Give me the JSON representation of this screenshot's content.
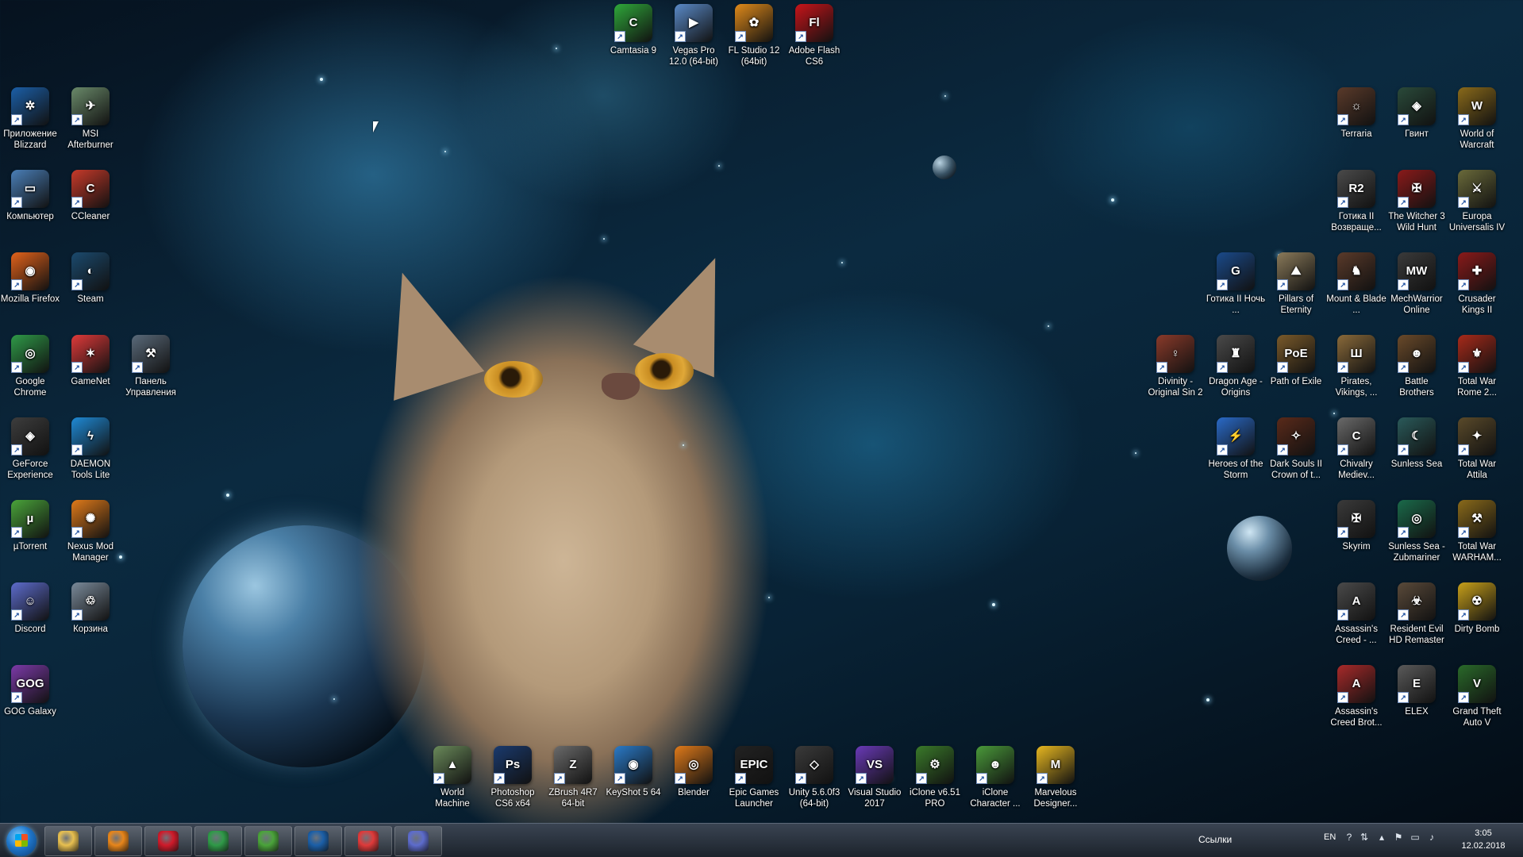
{
  "desktop": {
    "left_col1": [
      {
        "name": "blizzard-icon",
        "label": "Приложение Blizzard",
        "color": "#1b5fa8",
        "glyph": "✲"
      },
      {
        "name": "computer-icon",
        "label": "Компьютер",
        "color": "#4a7fb8",
        "glyph": "▭"
      },
      {
        "name": "firefox-icon",
        "label": "Mozilla Firefox",
        "color": "#e2621b",
        "glyph": "◉"
      },
      {
        "name": "chrome-icon",
        "label": "Google Chrome",
        "color": "#2f9a48",
        "glyph": "◎"
      },
      {
        "name": "geforce-icon",
        "label": "GeForce Experience",
        "color": "#3d3d3d",
        "glyph": "◈"
      },
      {
        "name": "utorrent-icon",
        "label": "µTorrent",
        "color": "#4aa43a",
        "glyph": "µ"
      },
      {
        "name": "discord-icon",
        "label": "Discord",
        "color": "#5d6ccd",
        "glyph": "☺"
      },
      {
        "name": "gog-icon",
        "label": "GOG Galaxy",
        "color": "#7c3aa8",
        "glyph": "GOG"
      }
    ],
    "left_col2": [
      {
        "name": "msi-afterburner-icon",
        "label": "MSI Afterburner",
        "color": "#6a8a6a",
        "glyph": "✈"
      },
      {
        "name": "ccleaner-icon",
        "label": "CCleaner",
        "color": "#c83a2a",
        "glyph": "C"
      },
      {
        "name": "steam-icon",
        "label": "Steam",
        "color": "#1b4a6e",
        "glyph": "◐"
      },
      {
        "name": "gamenet-icon",
        "label": "GameNet",
        "color": "#e03a3a",
        "glyph": "✶"
      },
      {
        "name": "daemon-tools-icon",
        "label": "DAEMON Tools Lite",
        "color": "#1f8ad6",
        "glyph": "ϟ"
      },
      {
        "name": "nexus-mod-icon",
        "label": "Nexus Mod Manager",
        "color": "#e07a1a",
        "glyph": "✺"
      },
      {
        "name": "recycle-bin-icon",
        "label": "Корзина",
        "color": "#7a8a9a",
        "glyph": "♲"
      }
    ],
    "left_col3": [
      {
        "name": "control-panel-icon",
        "label": "Панель Управления",
        "color": "#5a6a7a",
        "glyph": "⚒"
      }
    ],
    "top_row": [
      {
        "name": "camtasia-icon",
        "label": "Camtasia 9",
        "color": "#2fa83a",
        "glyph": "C"
      },
      {
        "name": "vegas-pro-icon",
        "label": "Vegas Pro 12.0 (64-bit)",
        "color": "#5a8ac8",
        "glyph": "▶"
      },
      {
        "name": "fl-studio-icon",
        "label": "FL Studio 12 (64bit)",
        "color": "#e08a1a",
        "glyph": "✿"
      },
      {
        "name": "adobe-flash-icon",
        "label": "Adobe Flash CS6",
        "color": "#c8141a",
        "glyph": "Fl"
      }
    ],
    "bottom_row": [
      {
        "name": "world-machine-icon",
        "label": "World Machine",
        "color": "#6a8a5a",
        "glyph": "▲"
      },
      {
        "name": "photoshop-icon",
        "label": "Photoshop CS6 x64",
        "color": "#1a3a6e",
        "glyph": "Ps"
      },
      {
        "name": "zbrush-icon",
        "label": "ZBrush 4R7 64-bit",
        "color": "#6a6a6a",
        "glyph": "Z"
      },
      {
        "name": "keyshot-icon",
        "label": "KeyShot 5 64",
        "color": "#2a7ac8",
        "glyph": "◉"
      },
      {
        "name": "blender-icon",
        "label": "Blender",
        "color": "#e07a1a",
        "glyph": "◎"
      },
      {
        "name": "epic-games-icon",
        "label": "Epic Games Launcher",
        "color": "#222222",
        "glyph": "EPIC"
      },
      {
        "name": "unity-icon",
        "label": "Unity 5.6.0f3 (64-bit)",
        "color": "#3a3a3a",
        "glyph": "◇"
      },
      {
        "name": "visual-studio-icon",
        "label": "Visual Studio 2017",
        "color": "#6a3ab8",
        "glyph": "VS"
      },
      {
        "name": "iclone-pro-icon",
        "label": "iClone v6.51 PRO",
        "color": "#3a7a2a",
        "glyph": "⚙"
      },
      {
        "name": "iclone-character-icon",
        "label": "iClone Character ...",
        "color": "#4a9a3a",
        "glyph": "☻"
      },
      {
        "name": "marvelous-designer-icon",
        "label": "Marvelous Designer...",
        "color": "#e8b820",
        "glyph": "M"
      }
    ],
    "right_grid": [
      {
        "name": "terraria-icon",
        "label": "Terraria",
        "color": "#5a3a2a",
        "glyph": "☼",
        "col": 5,
        "row": 0
      },
      {
        "name": "gwent-icon",
        "label": "Гвинт",
        "color": "#2a4a3a",
        "glyph": "◈",
        "col": 6,
        "row": 0
      },
      {
        "name": "wow-icon",
        "label": "World of Warcraft",
        "color": "#8a6a1a",
        "glyph": "W",
        "col": 7,
        "row": 0
      },
      {
        "name": "gothic2-icon",
        "label": "Готика II Возвраще...",
        "color": "#4a4a4a",
        "glyph": "R2",
        "col": 5,
        "row": 1
      },
      {
        "name": "witcher3-icon",
        "label": "The Witcher 3 Wild Hunt",
        "color": "#8a1a1a",
        "glyph": "✠",
        "col": 6,
        "row": 1
      },
      {
        "name": "europa-universalis-icon",
        "label": "Europa Universalis IV",
        "color": "#6a6a3a",
        "glyph": "⚔",
        "col": 7,
        "row": 1
      },
      {
        "name": "gothic2-night-icon",
        "label": "Готика II Ночь ...",
        "color": "#1a4a8a",
        "glyph": "G",
        "col": 4,
        "row": 2
      },
      {
        "name": "pillars-icon",
        "label": "Pillars of Eternity",
        "color": "#8a7a5a",
        "glyph": "⛰",
        "col": 5,
        "row": 2
      },
      {
        "name": "mount-blade-icon",
        "label": "Mount & Blade ...",
        "color": "#5a3a2a",
        "glyph": "♞",
        "col": 6,
        "row": 2
      },
      {
        "name": "mechwarrior-icon",
        "label": "MechWarrior Online",
        "color": "#3a3a3a",
        "glyph": "MW",
        "col": 7,
        "row": 2
      },
      {
        "name": "crusader-kings-icon",
        "label": "Crusader Kings II",
        "color": "#8a1a1a",
        "glyph": "✚",
        "col": 8,
        "row": 2
      },
      {
        "name": "divinity-icon",
        "label": "Divinity - Original Sin 2",
        "color": "#8a3a2a",
        "glyph": "♀",
        "col": 2,
        "row": 3
      },
      {
        "name": "dragon-age-icon",
        "label": "Dragon Age - Origins",
        "color": "#4a4a4a",
        "glyph": "♜",
        "col": 3,
        "row": 3
      },
      {
        "name": "path-of-exile-icon",
        "label": "Path of Exile",
        "color": "#7a5a2a",
        "glyph": "PoE",
        "col": 4,
        "row": 3
      },
      {
        "name": "pirates-vikings-icon",
        "label": "Pirates, Vikings, ...",
        "color": "#8a6a3a",
        "glyph": "Ш",
        "col": 5,
        "row": 3
      },
      {
        "name": "battle-brothers-icon",
        "label": "Battle Brothers",
        "color": "#6a4a2a",
        "glyph": "☻",
        "col": 6,
        "row": 3
      },
      {
        "name": "total-war-rome-icon",
        "label": "Total War Rome 2...",
        "color": "#a82a1a",
        "glyph": "⚜",
        "col": 7,
        "row": 3
      },
      {
        "name": "heroes-storm-icon",
        "label": "Heroes of the Storm",
        "color": "#2a6ac8",
        "glyph": "⚡",
        "col": 4,
        "row": 4
      },
      {
        "name": "dark-souls-icon",
        "label": "Dark Souls II Crown of t...",
        "color": "#5a2a1a",
        "glyph": "✧",
        "col": 5,
        "row": 4
      },
      {
        "name": "chivalry-icon",
        "label": "Chivalry Mediev...",
        "color": "#6a6a6a",
        "glyph": "C",
        "col": 6,
        "row": 4
      },
      {
        "name": "sunless-sea-icon",
        "label": "Sunless Sea",
        "color": "#2a5a5a",
        "glyph": "☾",
        "col": 7,
        "row": 4
      },
      {
        "name": "total-war-attila-icon",
        "label": "Total War Attila",
        "color": "#5a4a2a",
        "glyph": "✦",
        "col": 8,
        "row": 4
      },
      {
        "name": "skyrim-icon",
        "label": "Skyrim",
        "color": "#3a3a3a",
        "glyph": "✠",
        "col": 5,
        "row": 5
      },
      {
        "name": "sunless-sea-zubmariner-icon",
        "label": "Sunless Sea - Zubmariner",
        "color": "#1a6a4a",
        "glyph": "◎",
        "col": 6,
        "row": 5
      },
      {
        "name": "total-war-warhammer-icon",
        "label": "Total War WARHAM...",
        "color": "#8a6a1a",
        "glyph": "⚒",
        "col": 7,
        "row": 5
      },
      {
        "name": "assassins-creed-icon",
        "label": "Assassin's Creed - ...",
        "color": "#4a4a4a",
        "glyph": "A",
        "col": 5,
        "row": 6
      },
      {
        "name": "resident-evil-icon",
        "label": "Resident Evil HD Remaster",
        "color": "#5a4a3a",
        "glyph": "☣",
        "col": 6,
        "row": 6
      },
      {
        "name": "dirty-bomb-icon",
        "label": "Dirty Bomb",
        "color": "#c8a01a",
        "glyph": "☢",
        "col": 7,
        "row": 6
      },
      {
        "name": "assassins-creed-brotherhood-icon",
        "label": "Assassin's Creed Brot...",
        "color": "#a82a2a",
        "glyph": "A",
        "col": 5,
        "row": 7
      },
      {
        "name": "elex-icon",
        "label": "ELEX",
        "color": "#5a5a5a",
        "glyph": "E",
        "col": 6,
        "row": 7
      },
      {
        "name": "gta5-icon",
        "label": "Grand Theft Auto V",
        "color": "#2a6a2a",
        "glyph": "V",
        "col": 7,
        "row": 7
      }
    ]
  },
  "taskbar": {
    "apps": [
      {
        "name": "taskbar-explorer",
        "color": "#e8c050"
      },
      {
        "name": "taskbar-media-player",
        "color": "#e8861a"
      },
      {
        "name": "taskbar-opera",
        "color": "#d01a2a"
      },
      {
        "name": "taskbar-chrome",
        "color": "#2f9a48"
      },
      {
        "name": "taskbar-utorrent",
        "color": "#4aa43a"
      },
      {
        "name": "taskbar-blizzard",
        "color": "#1b5fa8"
      },
      {
        "name": "taskbar-gamenet",
        "color": "#e03a3a"
      },
      {
        "name": "taskbar-discord",
        "color": "#5d6ccd"
      }
    ],
    "links_label": "Ссылки",
    "language": "EN",
    "clock_time": "3:05",
    "clock_date": "12.02.2018"
  }
}
